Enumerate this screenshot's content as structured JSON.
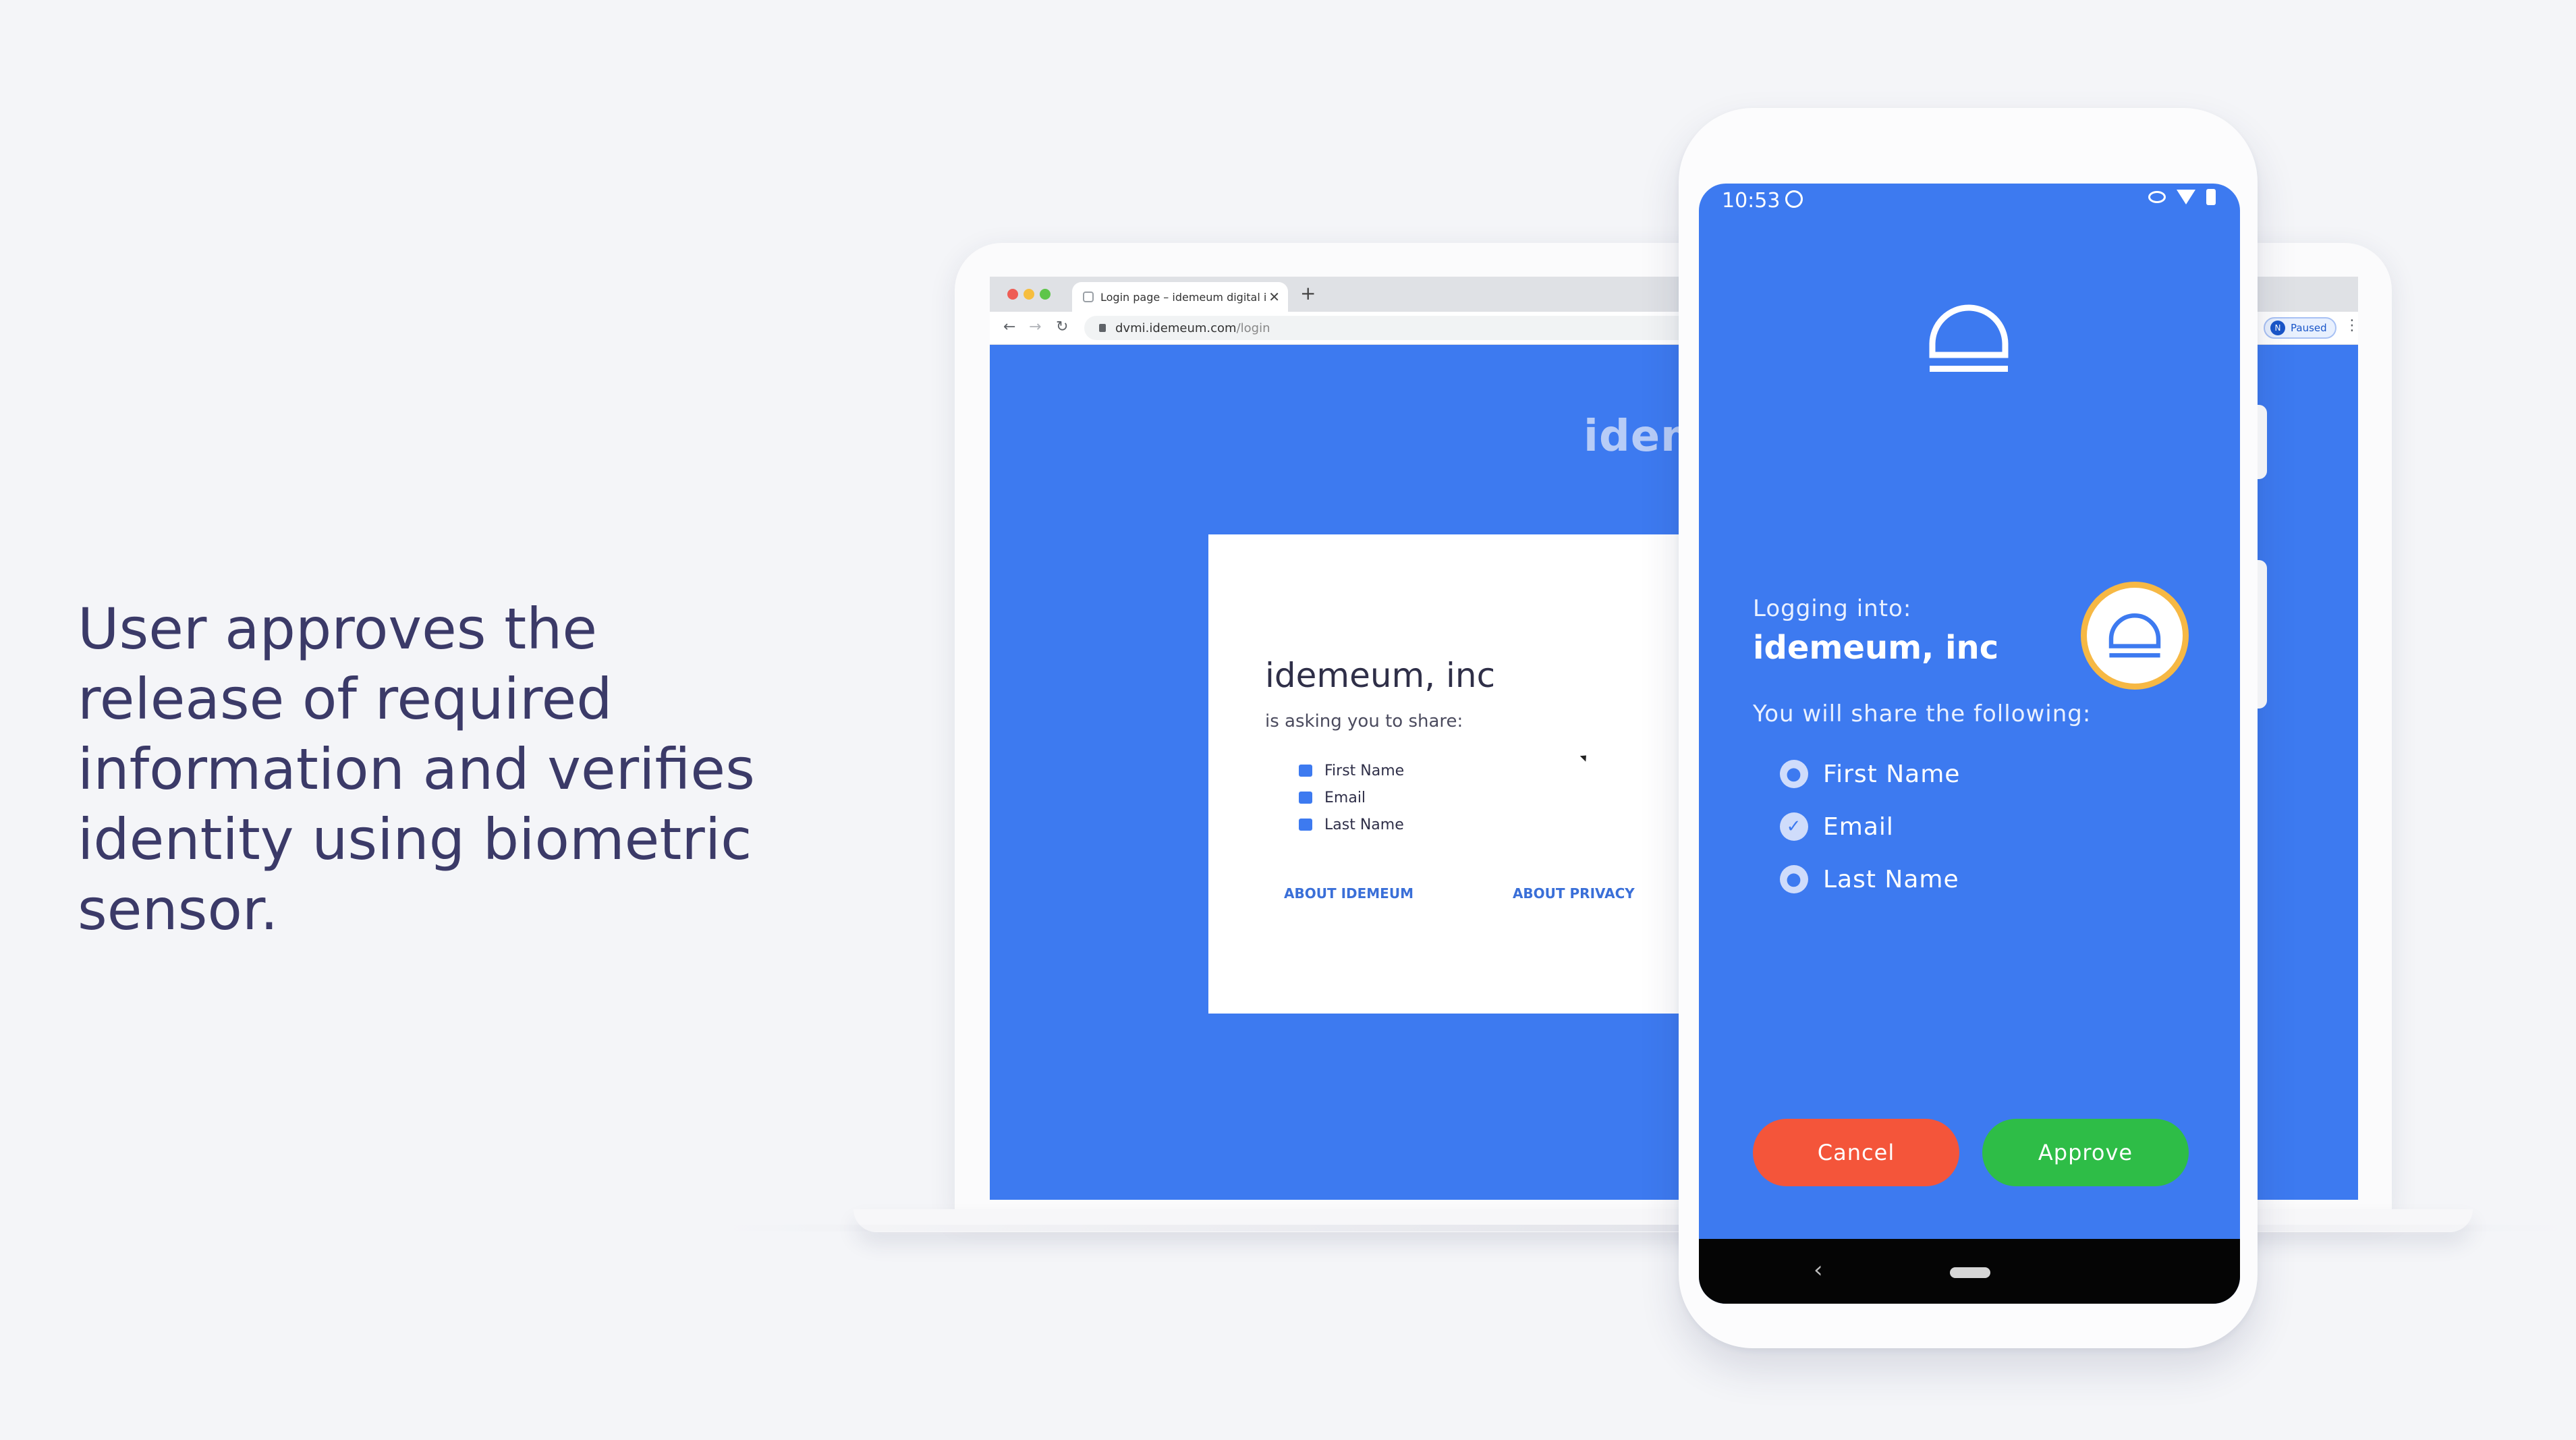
{
  "slide": {
    "headline_lines": [
      "User approves the",
      "release of required",
      "information and verifies",
      "identity using biometric",
      "sensor."
    ]
  },
  "browser": {
    "tab_title": "Login page – idemeum digital i",
    "url_host": "dvmi.idemeum.com",
    "url_path": "/login",
    "profile_initial": "N",
    "profile_status": "Paused",
    "brand_partial": "idem",
    "share_card": {
      "company": "idemeum, inc",
      "subtitle": "is asking you to share:",
      "items": [
        "First Name",
        "Email",
        "Last Name"
      ],
      "links": [
        "ABOUT IDEMEUM",
        "ABOUT PRIVACY"
      ]
    }
  },
  "phone": {
    "status_time": "10:53",
    "logging_label": "Logging into:",
    "company": "idemeum, inc",
    "share_label": "You will share the following:",
    "items": [
      {
        "label": "First Name",
        "icon": "person-icon"
      },
      {
        "label": "Email",
        "icon": "check-icon"
      },
      {
        "label": "Last Name",
        "icon": "person-icon"
      }
    ],
    "cancel_label": "Cancel",
    "approve_label": "Approve"
  },
  "colors": {
    "brand_blue": "#3d7af0",
    "cancel_red": "#f4553a",
    "approve_green": "#2ebd47",
    "badge_ring": "#f6b844",
    "headline": "#3b3a68"
  }
}
